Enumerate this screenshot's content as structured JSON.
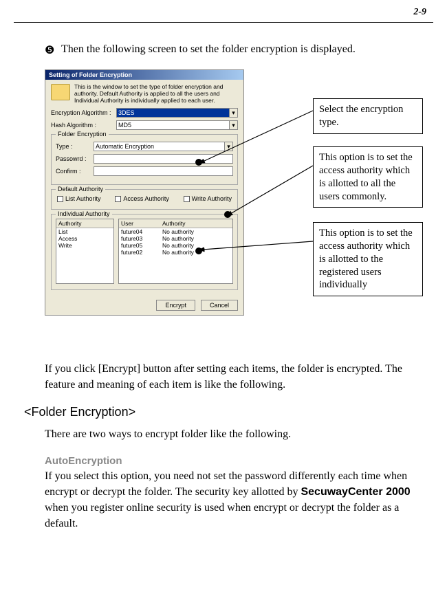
{
  "page_number": "2-9",
  "bullet_text": "Then the following screen to set the folder encryption is displayed.",
  "dialog": {
    "title": "Setting of Folder Encryption",
    "header_text": "This is the window to set the type of folder encryption and authority. Default Authority is applied to all the users and Individual Authority is individually applied to each user.",
    "enc_alg_label": "Encryption Algorithm :",
    "enc_alg_value": "3DES",
    "hash_alg_label": "Hash Algorithm :",
    "hash_alg_value": "MD5",
    "folder_enc_legend": "Folder Encryption",
    "type_label": "Type :",
    "type_value": "Automatic Encryption",
    "password_label": "Passowrd :",
    "confirm_label": "Confirm :",
    "default_auth_legend": "Default Authority",
    "list_auth": "List Authority",
    "access_auth": "Access Authority",
    "write_auth": "Write Authority",
    "individual_auth_legend": "Individual Authority",
    "left_header": "Authority",
    "left_rows": [
      "List",
      "Access",
      "Write"
    ],
    "right_header_user": "User",
    "right_header_auth": "Authority",
    "right_rows": [
      {
        "user": "future04",
        "auth": "No authority"
      },
      {
        "user": "future03",
        "auth": "No authority"
      },
      {
        "user": "future05",
        "auth": "No authority"
      },
      {
        "user": "future02",
        "auth": "No authority"
      }
    ],
    "encrypt_btn": "Encrypt",
    "cancel_btn": "Cancel"
  },
  "callouts": {
    "c1": "Select the encryption type.",
    "c2": "This option is to set the access authority which is allotted to all the users commonly.",
    "c3": "This option is to set the access authority which is allotted to the registered users individually"
  },
  "para1": "If you click [Encrypt] button after setting each items, the folder is encrypted. The feature and meaning of each item is like the following.",
  "section_title": "<Folder Encryption>",
  "para2": "There are two ways to encrypt folder like the following.",
  "subhead1": "AutoEncryption",
  "para3_a": "If you select this option, you need not set the password differently each time when encrypt or decrypt the folder. The security key allotted by ",
  "para3_bold": "SecuwayCenter 2000",
  "para3_b": " when you register online security is used when encrypt or decrypt the folder as a default."
}
